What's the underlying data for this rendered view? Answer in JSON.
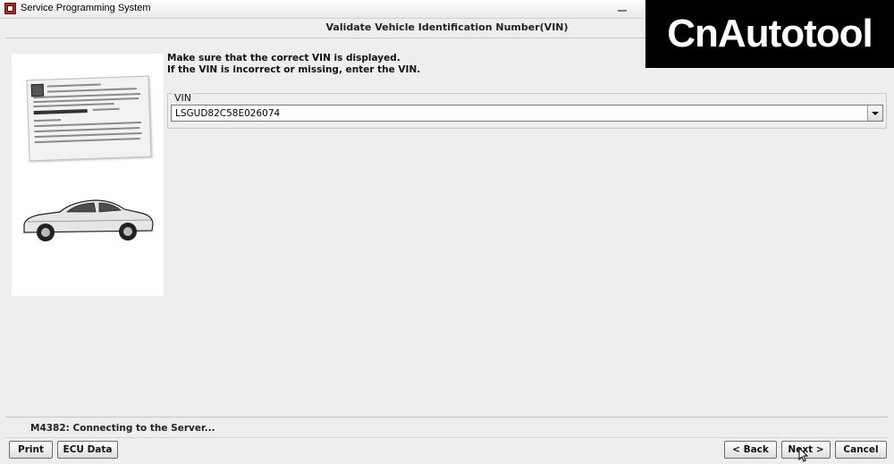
{
  "window": {
    "title": "Service Programming System"
  },
  "page": {
    "title": "Validate Vehicle Identification Number(VIN)"
  },
  "instructions": [
    "Make sure that the correct VIN is displayed.",
    "If the VIN is incorrect or missing, enter the VIN."
  ],
  "vin": {
    "group_label": "VIN",
    "value": "LSGUD82C58E026074"
  },
  "status": {
    "message": "M4382: Connecting to the Server..."
  },
  "buttons": {
    "print": "Print",
    "ecu_data": "ECU Data",
    "back": "< Back",
    "next": "Next >",
    "cancel": "Cancel"
  },
  "watermark": {
    "text": "CnAutotool"
  },
  "colors": {
    "window_bg": "#eeeeee",
    "panel_bg": "#ffffff",
    "watermark_bg": "#000000"
  },
  "icons": [
    "app-icon",
    "vehicle-label-image",
    "car-image",
    "dropdown-arrow-icon",
    "mouse-pointer-icon"
  ]
}
